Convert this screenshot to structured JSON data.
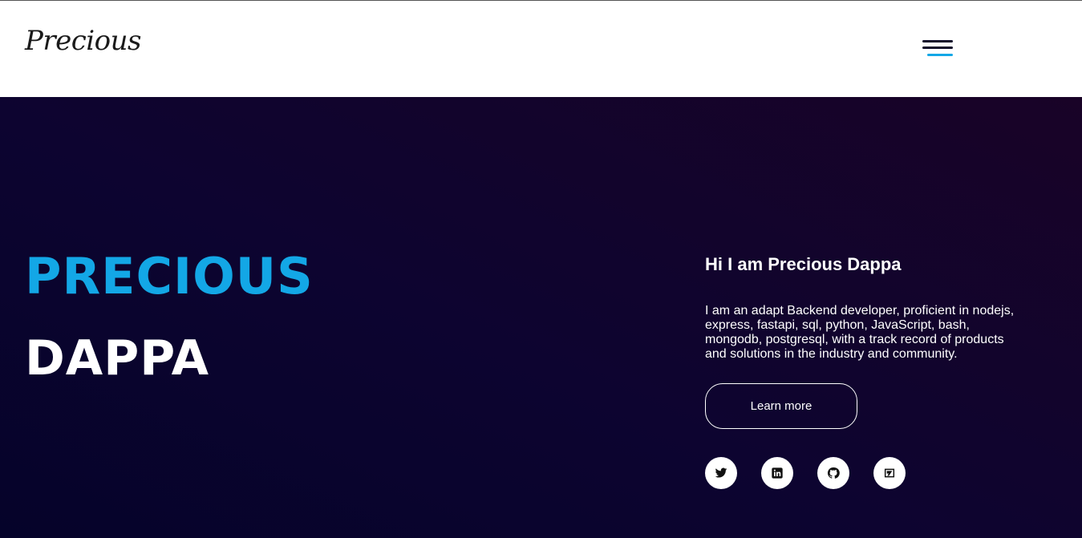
{
  "header": {
    "logo_text": "Precious",
    "menu_icon": "hamburger-menu-icon",
    "accent_color": "#13a7e6"
  },
  "hero": {
    "first_name": "PRECIOUS",
    "last_name": "DAPPA",
    "greeting": "Hi I am Precious Dappa",
    "bio": "I am an adapt Backend developer, proficient in nodejs, express, fastapi, sql, python, JavaScript, bash, mongodb, postgresql, with a track record of products and solutions in the industry and community.",
    "cta_label": "Learn more",
    "background_colors": [
      "#05032a",
      "#190327"
    ],
    "socials": [
      {
        "icon": "twitter-icon"
      },
      {
        "icon": "linkedin-icon"
      },
      {
        "icon": "github-icon"
      },
      {
        "icon": "hashnode-icon"
      }
    ]
  }
}
